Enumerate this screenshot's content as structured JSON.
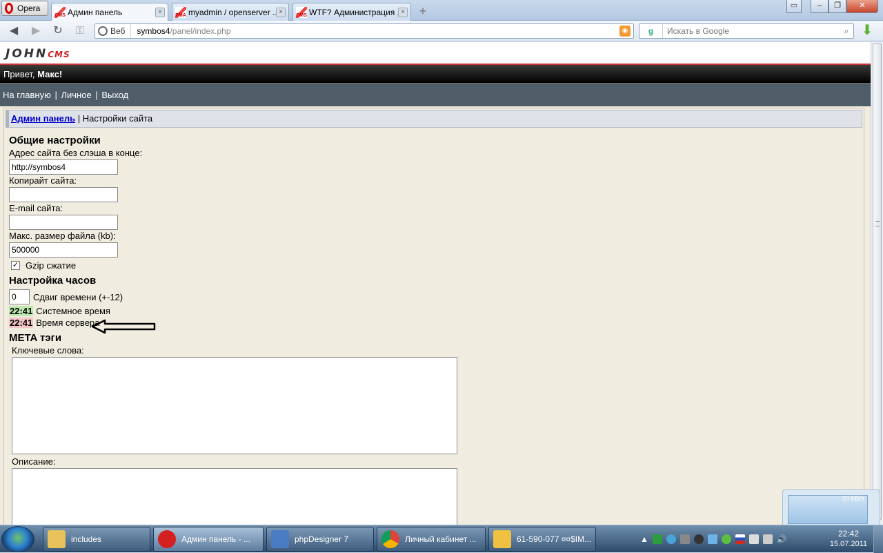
{
  "browser": {
    "menu_label": "Opera",
    "tabs": [
      {
        "favicon": "CMS",
        "label": "Админ панель",
        "active": true
      },
      {
        "favicon": "PMA",
        "label": "myadmin / openserver ...",
        "active": false
      },
      {
        "favicon": "CMS",
        "label": "WTF? Администрация ...",
        "active": false
      }
    ],
    "newtab_glyph": "+",
    "address": {
      "mode": "Веб",
      "host": "symbos4",
      "path": "/panel/index.php"
    },
    "search": {
      "engine": "g",
      "placeholder": "Искать в Google"
    }
  },
  "cms": {
    "logo_main": "JOHN",
    "logo_sub": "CMS",
    "greeting_prefix": "Привет, ",
    "greeting_name": "Макс!",
    "nav": [
      "На главную",
      "Личное",
      "Выход"
    ],
    "nav_sep": "|",
    "breadcrumb_link": "Админ панель",
    "breadcrumb_sep": " | ",
    "breadcrumb_current": "Настройки сайта"
  },
  "form": {
    "general_title": "Общие настройки",
    "site_url_label": "Адрес сайта без слэша в конце:",
    "site_url_value": "http://symbos4",
    "copyright_label": "Копирайт сайта:",
    "copyright_value": "",
    "email_label": "E-mail сайта:",
    "email_value": "",
    "maxsize_label": "Макс. размер файла (kb):",
    "maxsize_value": "500000",
    "gzip_label": "Gzip сжатие",
    "gzip_checked": true,
    "gzip_check_glyph": "✓",
    "clock_title": "Настройка часов",
    "timeshift_value": "0",
    "timeshift_label": "Сдвиг времени (+-12)",
    "system_time": "22:41",
    "system_time_label": "Системное время",
    "server_time": "22:41",
    "server_time_label": "Время сервера",
    "meta_title": "META тэги",
    "keywords_label": "Ключевые слова:",
    "keywords_value": "",
    "description_label": "Описание:",
    "description_value": ""
  },
  "netwidget": {
    "rate": "20 KB/s"
  },
  "taskbar": {
    "buttons": [
      {
        "icon": "folder-icon",
        "label": "includes",
        "color": "#e8c25a"
      },
      {
        "icon": "opera-icon",
        "label": "Админ панель - ...",
        "color": "#d42020"
      },
      {
        "icon": "phpdesigner-icon",
        "label": "phpDesigner 7",
        "color": "#4a7cc4"
      },
      {
        "icon": "chrome-icon",
        "label": "Личный кабинет ...",
        "color": "#e0b020"
      },
      {
        "icon": "mail-icon",
        "label": "61-590-077 ¤¤$IM...",
        "color": "#f0c040"
      }
    ],
    "clock_time": "22:42",
    "clock_date": "15.07.2011"
  },
  "colors": {
    "page_bg": "#f0ede0",
    "nav_bg": "#4f5d69",
    "link": "#0000cc",
    "accent_red": "#cc2222"
  }
}
